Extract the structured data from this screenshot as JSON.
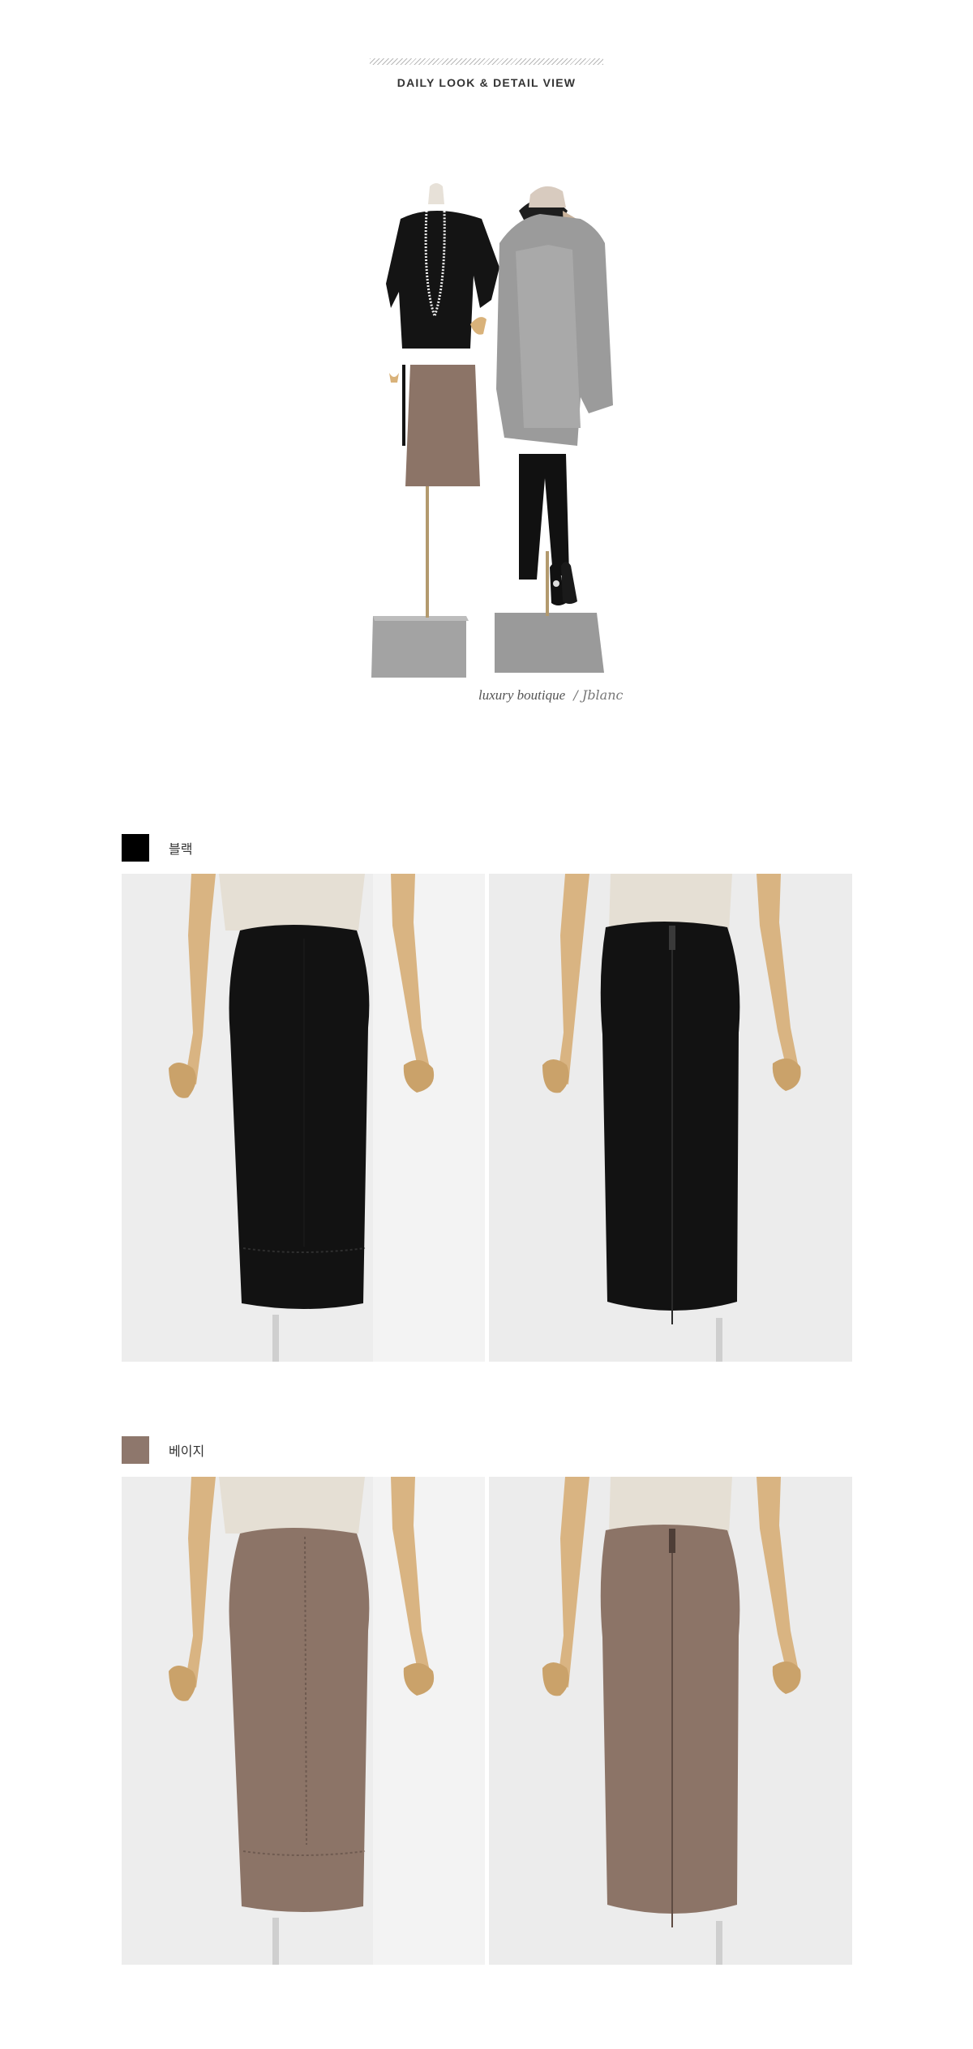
{
  "header": {
    "title": "DAILY LOOK & DETAIL VIEW"
  },
  "hero": {
    "caption_text": "luxury boutique",
    "caption_signature": "/ Jblanc"
  },
  "colors": [
    {
      "label": "블랙",
      "swatch_hex": "#000000",
      "skirt_hex": "#121212",
      "photos": [
        {
          "view": "front",
          "alt": "black skirt front"
        },
        {
          "view": "back",
          "alt": "black skirt back"
        }
      ]
    },
    {
      "label": "베이지",
      "swatch_hex": "#8e776c",
      "skirt_hex": "#8c7467",
      "photos": [
        {
          "view": "front",
          "alt": "beige skirt front"
        },
        {
          "view": "back",
          "alt": "beige skirt back"
        }
      ]
    }
  ]
}
